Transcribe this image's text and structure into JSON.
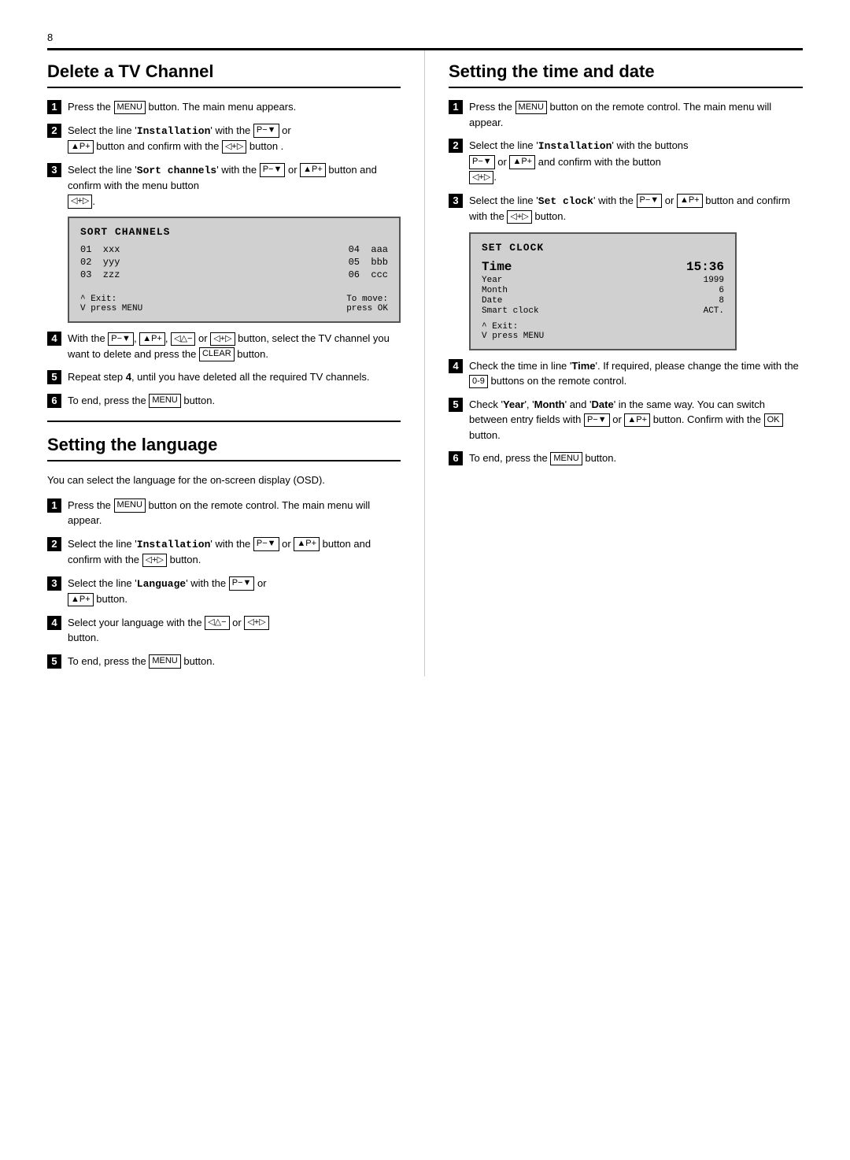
{
  "page": {
    "number": "8",
    "top_rule": true
  },
  "delete_tv_channel": {
    "title": "Delete a TV Channel",
    "steps": [
      {
        "num": "1",
        "text": "Press the ",
        "btn": "MENU",
        "after": " button. The main menu appears."
      },
      {
        "num": "2",
        "text_parts": [
          "Select the line '",
          "Installation",
          "' with the ",
          "P−▼",
          " or ",
          "▲P+",
          " button and confirm with the ",
          "◁+▷",
          " button ."
        ]
      },
      {
        "num": "3",
        "text_parts": [
          "Select the line '",
          "Sort channels",
          "' with the ",
          "P−▼",
          " or ",
          "▲P+",
          " button and confirm with the menu button ",
          "◁+▷",
          "."
        ]
      },
      {
        "num": "4",
        "text_parts": [
          "With the ",
          "P−▼",
          ", ",
          "▲P+",
          ", ",
          "◁△−",
          " or ",
          "◁+▷",
          " button, select the TV channel you want to delete and press the ",
          "CLEAR",
          " button."
        ]
      },
      {
        "num": "5",
        "text_parts": [
          "Repeat step ",
          "4",
          ", until you have deleted all the required TV channels."
        ]
      },
      {
        "num": "6",
        "text_parts": [
          "To end, press the ",
          "MENU",
          " button."
        ]
      }
    ],
    "screen": {
      "title": "SORT CHANNELS",
      "rows": [
        {
          "left": "01  xxx",
          "right": "04  aaa"
        },
        {
          "left": "02  yyy",
          "right": "05  bbb"
        },
        {
          "left": "03  zzz",
          "right": "06  ccc"
        }
      ],
      "footer_left": "^ Exit:",
      "footer_right": "To move:",
      "footer_left2": "V press MENU",
      "footer_right2": "press OK"
    }
  },
  "setting_time_date": {
    "title": "Setting the time and date",
    "steps": [
      {
        "num": "1",
        "text_parts": [
          "Press the ",
          "MENU",
          " button on the remote control. The main menu will appear."
        ]
      },
      {
        "num": "2",
        "text_parts": [
          "Select the line '",
          "Installation",
          "' with the buttons ",
          "P−▼",
          " or ",
          "▲P+",
          " and confirm with the button ",
          "◁+▷",
          "."
        ]
      },
      {
        "num": "3",
        "text_parts": [
          "Select the line '",
          "Set clock",
          "' with the ",
          "P−▼",
          " or ",
          "▲P+",
          " button and confirm with the ",
          "◁+▷",
          " button."
        ]
      },
      {
        "num": "4",
        "text_parts": [
          "Check the time in line '",
          "Time",
          "'. If required, please change the time with the ",
          "0-9",
          " buttons on the remote control."
        ]
      },
      {
        "num": "5",
        "text_parts": [
          "Check '",
          "Year",
          "', '",
          "Month",
          "' and '",
          "Date",
          "' in the same way. You can switch between entry fields with ",
          "P−▼",
          " or ",
          "▲P+",
          " button. Confirm with the ",
          "OK",
          " button."
        ]
      },
      {
        "num": "6",
        "text_parts": [
          "To end, press the ",
          "MENU",
          " button."
        ]
      }
    ],
    "screen": {
      "title": "SET CLOCK",
      "time_label": "Time",
      "time_value": "15:36",
      "rows": [
        {
          "label": "Year",
          "value": "1999"
        },
        {
          "label": "Month",
          "value": "6"
        },
        {
          "label": "Date",
          "value": "8"
        },
        {
          "label": "Smart clock",
          "value": "ACT."
        }
      ],
      "footer_left": "^ Exit:",
      "footer_left2": "V press MENU"
    }
  },
  "setting_language": {
    "title": "Setting the language",
    "intro": "You can select the language for the on-screen display (OSD).",
    "steps": [
      {
        "num": "1",
        "text_parts": [
          "Press the ",
          "MENU",
          " button on the remote control. The main menu will appear."
        ]
      },
      {
        "num": "2",
        "text_parts": [
          "Select the line '",
          "Installation",
          "' with the ",
          "P−▼",
          " or ",
          "▲P+",
          " button and confirm with the ",
          "◁+▷",
          " button."
        ]
      },
      {
        "num": "3",
        "text_parts": [
          "Select the line '",
          "Language",
          "' with the ",
          "P−▼",
          " or ",
          "▲P+",
          " button."
        ]
      },
      {
        "num": "4",
        "text_parts": [
          "Select your language with the ",
          "◁△−",
          " or ",
          "◁+▷",
          " button."
        ]
      },
      {
        "num": "5",
        "text_parts": [
          "To end, press the ",
          "MENU",
          " button."
        ]
      }
    ]
  }
}
